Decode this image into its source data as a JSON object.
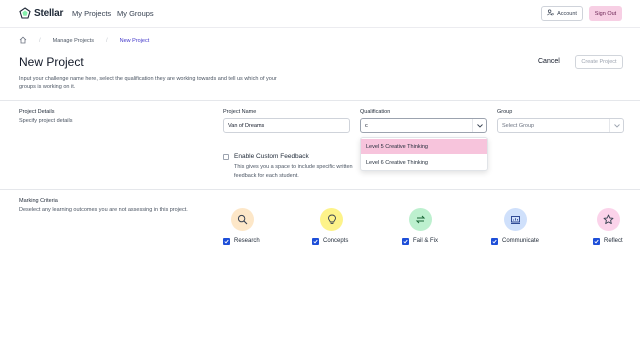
{
  "app": {
    "name": "Stellar"
  },
  "nav": {
    "links": [
      "My Projects",
      "My Groups"
    ],
    "account_label": "Account",
    "signout_label": "Sign Out"
  },
  "breadcrumb": {
    "items": [
      "Manage Projects",
      "New Project"
    ]
  },
  "header": {
    "title": "New Project",
    "description": "Input your challenge name here, select the qualification they are working towards and tell us which of your groups is working on it.",
    "cancel_label": "Cancel",
    "create_label": "Create Project"
  },
  "project_details": {
    "title": "Project Details",
    "subtitle": "Specify project details",
    "name": {
      "label": "Project Name",
      "value": "Van of Dreams"
    },
    "qualification": {
      "label": "Qualification",
      "value": "c",
      "options": [
        "Level 5 Creative Thinking",
        "Level 6 Creative Thinking"
      ],
      "highlighted": "Level 5 Creative Thinking"
    },
    "group": {
      "label": "Group",
      "placeholder": "Select Group"
    },
    "feedback": {
      "label": "Enable Custom Feedback",
      "description": "This gives you a space to include specific written feedback for each student.",
      "checked": false
    }
  },
  "marking_criteria": {
    "title": "Marking Criteria",
    "subtitle": "Deselect any learning outcomes you are not assessing in this project.",
    "items": [
      {
        "label": "Research",
        "icon": "magnifier-icon",
        "color": "#fde7c8",
        "checked": true
      },
      {
        "label": "Concepts",
        "icon": "lightbulb-icon",
        "color": "#fdf38a",
        "checked": true
      },
      {
        "label": "Fail & Fix",
        "icon": "refresh-icon",
        "color": "#bdf0cf",
        "checked": true
      },
      {
        "label": "Communicate",
        "icon": "presentation-icon",
        "color": "#cfe0fb",
        "checked": true
      },
      {
        "label": "Reflect",
        "icon": "star-icon",
        "color": "#fbd3ea",
        "checked": true
      }
    ]
  },
  "colors": {
    "accent": "#1d4ed8",
    "breadcrumb_active": "#4338ca",
    "signout_bg": "#f7cfe4",
    "dropdown_highlight": "#f7c4dc"
  }
}
